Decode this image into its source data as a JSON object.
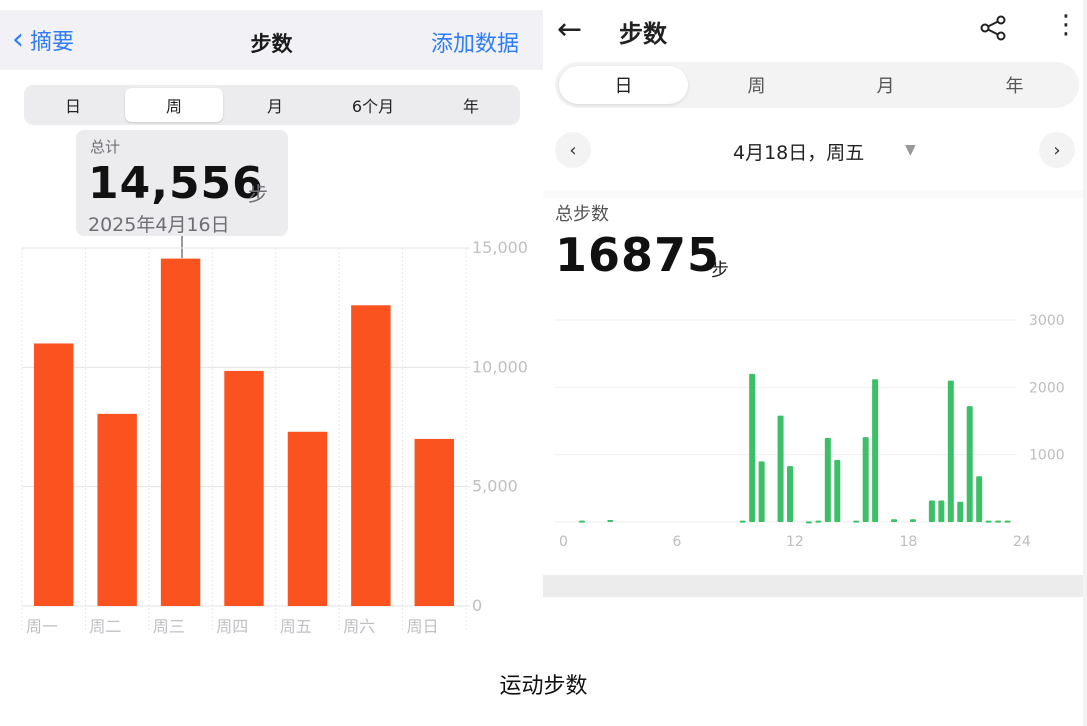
{
  "left": {
    "nav": {
      "back_label": "摘要",
      "title": "步数",
      "add_label": "添加数据"
    },
    "segments": [
      "日",
      "周",
      "月",
      "6个月",
      "年"
    ],
    "active_segment": 1,
    "tooltip": {
      "label": "总计",
      "value": "14,556",
      "unit": "步",
      "date": "2025年4月16日"
    },
    "chart_data": {
      "type": "bar",
      "categories": [
        "周一",
        "周二",
        "周三",
        "周四",
        "周五",
        "周六",
        "周日"
      ],
      "values": [
        11000,
        8050,
        14556,
        9850,
        7300,
        12600,
        7000
      ],
      "ylim": [
        0,
        15000
      ],
      "yticks": [
        "0",
        "5,000",
        "10,000",
        "15,000"
      ],
      "ytick_values": [
        0,
        5000,
        10000,
        15000
      ],
      "grid": true,
      "color": "#fa5320"
    }
  },
  "right": {
    "title": "步数",
    "segments": [
      "日",
      "周",
      "月",
      "年"
    ],
    "active_segment": 0,
    "date_label": "4月18日，周五",
    "total_label": "总步数",
    "total_value": "16875",
    "total_unit": "步",
    "chart_data": {
      "type": "bar",
      "x": [
        1,
        2.5,
        9.5,
        10,
        10.5,
        11.5,
        12,
        13,
        13.5,
        14,
        14.5,
        15.5,
        16,
        16.5,
        17.5,
        18.5,
        19.5,
        20,
        20.5,
        21,
        21.5,
        22,
        22.5,
        23,
        23.5
      ],
      "values": [
        20,
        30,
        20,
        2200,
        900,
        1580,
        830,
        10,
        20,
        1250,
        920,
        20,
        1260,
        2120,
        40,
        40,
        320,
        320,
        2100,
        300,
        1720,
        680,
        20,
        20,
        20
      ],
      "xticks": [
        "0",
        "6",
        "12",
        "18",
        "24"
      ],
      "xtick_values": [
        0,
        6,
        12,
        18,
        24
      ],
      "yticks": [
        "1000",
        "2000",
        "3000"
      ],
      "ytick_values": [
        1000,
        2000,
        3000
      ],
      "xlim": [
        0,
        24
      ],
      "ylim": [
        0,
        3000
      ],
      "color": "#3cbf66"
    }
  },
  "caption": "运动步数"
}
